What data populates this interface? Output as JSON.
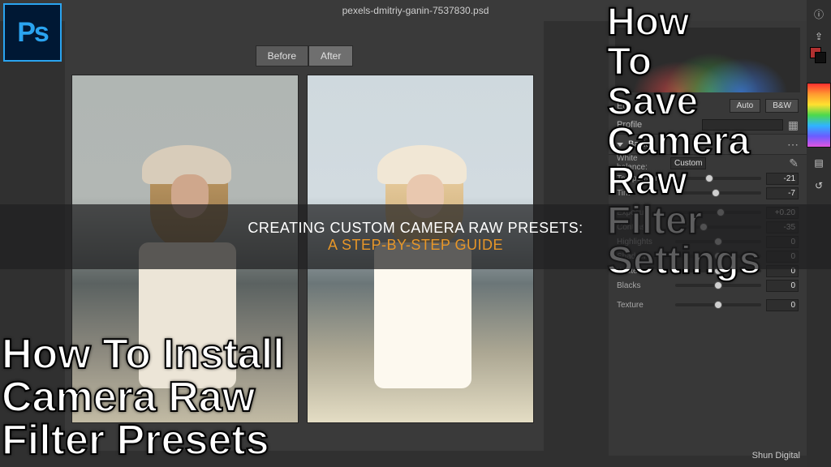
{
  "filename": "pexels-dmitriy-ganin-7537830.psd",
  "tabs": {
    "before": "Before",
    "after": "After"
  },
  "sidebar": {
    "edit_label": "Edit",
    "auto_label": "Auto",
    "bw_label": "B&W",
    "profile_label": "Profile",
    "sections": {
      "basic": "Basic"
    },
    "white_balance_label": "White balance:",
    "white_balance_value": "Custom",
    "sliders": [
      {
        "label": "Temperature",
        "value": "-21",
        "pos": 40
      },
      {
        "label": "Tint",
        "value": "-7",
        "pos": 47
      },
      {
        "label": "Exposure",
        "value": "+0.20",
        "pos": 53
      },
      {
        "label": "Contrast",
        "value": "-35",
        "pos": 33
      },
      {
        "label": "Highlights",
        "value": "0",
        "pos": 50
      },
      {
        "label": "Shadows",
        "value": "0",
        "pos": 50
      },
      {
        "label": "Whites",
        "value": "0",
        "pos": 50
      },
      {
        "label": "Blacks",
        "value": "0",
        "pos": 50
      },
      {
        "label": "Texture",
        "value": "0",
        "pos": 50
      }
    ]
  },
  "overlays": {
    "save_lines": [
      "How",
      "To",
      "Save",
      "Camera",
      "Raw",
      "Filter",
      "Settings"
    ],
    "install_lines": [
      "How To Install",
      "Camera Raw",
      "Filter Presets"
    ]
  },
  "banner": {
    "line1": "CREATING CUSTOM CAMERA RAW PRESETS:",
    "line2": "A STEP-BY-STEP GUIDE"
  },
  "credit": "Shun Digital",
  "toolstrip_icons": [
    "info-icon",
    "share-icon",
    "export-icon",
    "layers-icon",
    "history-icon"
  ]
}
